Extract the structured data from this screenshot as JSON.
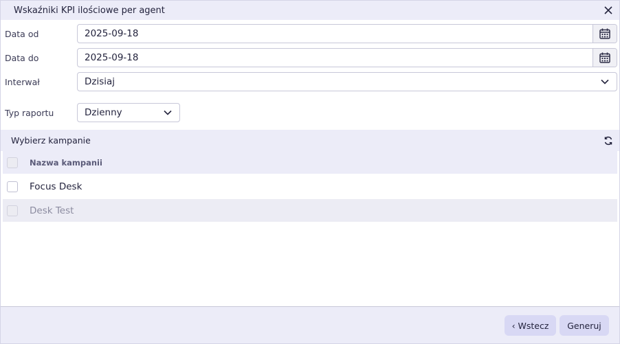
{
  "dialog": {
    "title": "Wskaźniki KPI ilościowe per agent"
  },
  "form": {
    "date_from": {
      "label": "Data od",
      "value": "2025-09-18"
    },
    "date_to": {
      "label": "Data do",
      "value": "2025-09-18"
    },
    "interval": {
      "label": "Interwał",
      "value": "Dzisiaj"
    },
    "report_type": {
      "label": "Typ raportu",
      "value": "Dzienny"
    }
  },
  "campaigns": {
    "title": "Wybierz kampanie",
    "column_header": "Nazwa kampanii",
    "rows": [
      {
        "name": "Focus Desk",
        "checked": false,
        "disabled": false
      },
      {
        "name": "Desk Test",
        "checked": false,
        "disabled": true
      }
    ]
  },
  "footer": {
    "back_label": "‹ Wstecz",
    "generate_label": "Generuj"
  },
  "icons": {
    "close": "close-icon",
    "calendar": "calendar-icon",
    "chevron": "chevron-down-icon",
    "refresh": "refresh-icon"
  }
}
